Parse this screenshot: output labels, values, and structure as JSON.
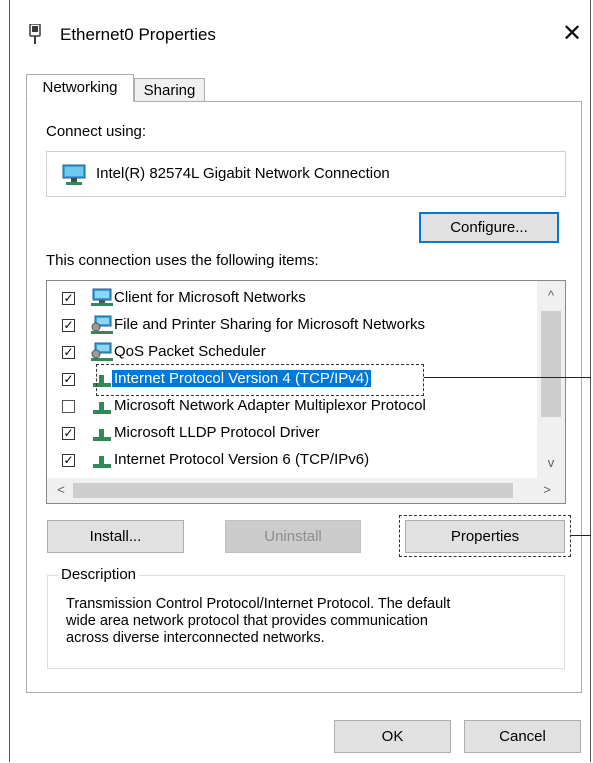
{
  "window": {
    "title": "Ethernet0 Properties",
    "close_glyph": "✕"
  },
  "tabs": [
    {
      "label": "Networking",
      "active": true
    },
    {
      "label": "Sharing",
      "active": false
    }
  ],
  "connect_using": {
    "label": "Connect using:",
    "adapter_name": "Intel(R) 82574L Gigabit Network Connection",
    "adapter_icon": "network-adapter-icon",
    "configure_label": "Configure..."
  },
  "items_section": {
    "label": "This connection uses the following items:",
    "items": [
      {
        "label": "Client for Microsoft Networks",
        "checked": true,
        "icon": "client-network-icon"
      },
      {
        "label": "File and Printer Sharing for Microsoft Networks",
        "checked": true,
        "icon": "service-network-icon"
      },
      {
        "label": "QoS Packet Scheduler",
        "checked": true,
        "icon": "service-network-icon"
      },
      {
        "label": "Internet Protocol Version 4 (TCP/IPv4)",
        "checked": true,
        "selected": true,
        "icon": "protocol-icon"
      },
      {
        "label": "Microsoft Network Adapter Multiplexor Protocol",
        "checked": false,
        "icon": "protocol-icon"
      },
      {
        "label": "Microsoft LLDP Protocol Driver",
        "checked": true,
        "icon": "protocol-icon"
      },
      {
        "label": "Internet Protocol Version 6 (TCP/IPv6)",
        "checked": true,
        "icon": "protocol-icon"
      }
    ],
    "checkmark_glyph": "✓",
    "scroll_up_glyph": "^",
    "scroll_down_glyph": "v",
    "scroll_left_glyph": "<",
    "scroll_right_glyph": ">"
  },
  "actions": {
    "install_label": "Install...",
    "uninstall_label": "Uninstall",
    "properties_label": "Properties"
  },
  "description": {
    "legend": "Description",
    "text_line1": "Transmission Control Protocol/Internet Protocol. The default",
    "text_line2": "wide area network protocol that provides communication",
    "text_line3": "across diverse interconnected networks."
  },
  "footer": {
    "ok_label": "OK",
    "cancel_label": "Cancel"
  },
  "colors": {
    "selection": "#0078d7",
    "button_face": "#e1e1e1",
    "disabled_button": "#cccccc"
  }
}
